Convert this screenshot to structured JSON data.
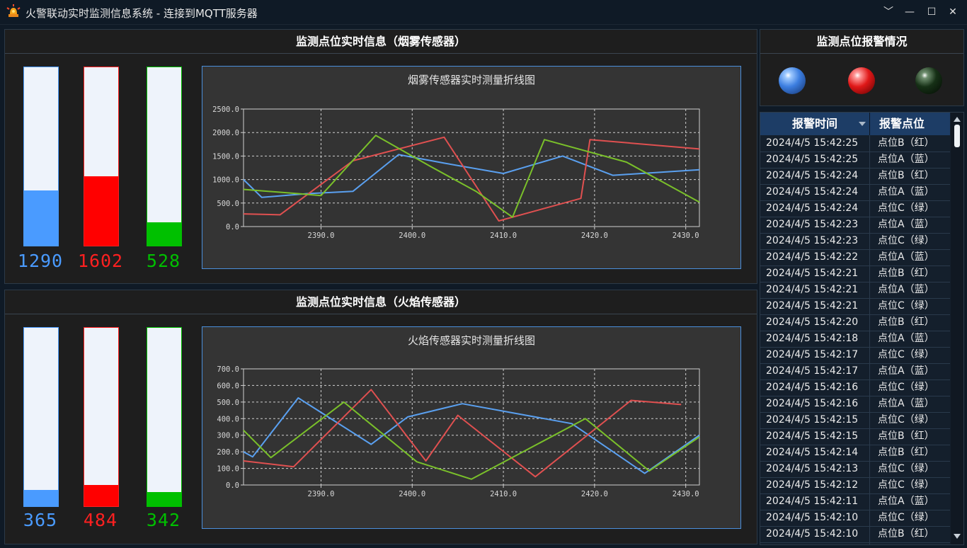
{
  "window": {
    "title": "火警联动实时监测信息系统 - 连接到MQTT服务器",
    "controls": [
      "﹀",
      "—",
      "☐",
      "✕"
    ]
  },
  "smoke_panel": {
    "title": "监测点位实时信息（烟雾传感器）",
    "readouts": [
      {
        "value": "1290",
        "level": 0.31,
        "color": "#4a9bff"
      },
      {
        "value": "1602",
        "level": 0.39,
        "color": "#ff0000"
      },
      {
        "value": "528",
        "level": 0.13,
        "color": "#00c000"
      }
    ],
    "chart_title": "烟雾传感器实时测量折线图"
  },
  "flame_panel": {
    "title": "监测点位实时信息（火焰传感器）",
    "readouts": [
      {
        "value": "365",
        "level": 0.09,
        "color": "#4a9bff"
      },
      {
        "value": "484",
        "level": 0.12,
        "color": "#ff0000"
      },
      {
        "value": "342",
        "level": 0.08,
        "color": "#00c000"
      }
    ],
    "chart_title": "火焰传感器实时测量折线图"
  },
  "alarm_panel": {
    "title": "监测点位报警情况",
    "lights": [
      {
        "name": "blue",
        "state": "on"
      },
      {
        "name": "red",
        "state": "on"
      },
      {
        "name": "green",
        "state": "off"
      }
    ]
  },
  "alarm_table": {
    "columns": [
      "报警时间",
      "报警点位"
    ],
    "rows": [
      [
        "2024/4/5 15:42:25",
        "点位B（红）"
      ],
      [
        "2024/4/5 15:42:25",
        "点位A（蓝）"
      ],
      [
        "2024/4/5 15:42:24",
        "点位B（红）"
      ],
      [
        "2024/4/5 15:42:24",
        "点位A（蓝）"
      ],
      [
        "2024/4/5 15:42:24",
        "点位C（绿）"
      ],
      [
        "2024/4/5 15:42:23",
        "点位A（蓝）"
      ],
      [
        "2024/4/5 15:42:23",
        "点位C（绿）"
      ],
      [
        "2024/4/5 15:42:22",
        "点位A（蓝）"
      ],
      [
        "2024/4/5 15:42:21",
        "点位B（红）"
      ],
      [
        "2024/4/5 15:42:21",
        "点位A（蓝）"
      ],
      [
        "2024/4/5 15:42:21",
        "点位C（绿）"
      ],
      [
        "2024/4/5 15:42:20",
        "点位B（红）"
      ],
      [
        "2024/4/5 15:42:18",
        "点位A（蓝）"
      ],
      [
        "2024/4/5 15:42:17",
        "点位C（绿）"
      ],
      [
        "2024/4/5 15:42:17",
        "点位A（蓝）"
      ],
      [
        "2024/4/5 15:42:16",
        "点位C（绿）"
      ],
      [
        "2024/4/5 15:42:16",
        "点位A（蓝）"
      ],
      [
        "2024/4/5 15:42:15",
        "点位C（绿）"
      ],
      [
        "2024/4/5 15:42:15",
        "点位B（红）"
      ],
      [
        "2024/4/5 15:42:14",
        "点位B（红）"
      ],
      [
        "2024/4/5 15:42:13",
        "点位C（绿）"
      ],
      [
        "2024/4/5 15:42:12",
        "点位C（绿）"
      ],
      [
        "2024/4/5 15:42:11",
        "点位A（蓝）"
      ],
      [
        "2024/4/5 15:42:10",
        "点位C（绿）"
      ],
      [
        "2024/4/5 15:42:10",
        "点位B（红）"
      ]
    ]
  },
  "chart_data": [
    {
      "type": "line",
      "title": "烟雾传感器实时测量折线图",
      "xlim": [
        2381.5,
        2431.5
      ],
      "ylim": [
        0,
        2500
      ],
      "xticks": [
        "2390.0",
        "2400.0",
        "2410.0",
        "2420.0",
        "2430.0"
      ],
      "yticks": [
        "0.0",
        "500.0",
        "1000.0",
        "1500.0",
        "2000.0",
        "2500.0"
      ],
      "grid": true,
      "series": [
        {
          "color": "#5aa0f0",
          "x": [
            2381.5,
            2383.5,
            2388.5,
            2393.5,
            2398.5,
            2403.5,
            2410.0,
            2416.5,
            2422.0,
            2431.5
          ],
          "y": [
            1000,
            620,
            700,
            750,
            1530,
            1350,
            1130,
            1500,
            1090,
            1210
          ]
        },
        {
          "color": "#e05050",
          "x": [
            2381.5,
            2385.5,
            2393.5,
            2403.5,
            2409.5,
            2418.5,
            2419.5,
            2431.5
          ],
          "y": [
            270,
            250,
            1400,
            1900,
            120,
            600,
            1850,
            1650
          ]
        },
        {
          "color": "#7ac02a",
          "x": [
            2381.5,
            2387.5,
            2390.0,
            2396.0,
            2402.0,
            2407.0,
            2411.0,
            2414.5,
            2423.5,
            2431.5
          ],
          "y": [
            790,
            700,
            660,
            1940,
            1280,
            750,
            200,
            1850,
            1370,
            520
          ]
        }
      ]
    },
    {
      "type": "line",
      "title": "火焰传感器实时测量折线图",
      "xlim": [
        2381.5,
        2431.5
      ],
      "ylim": [
        0,
        700
      ],
      "xticks": [
        "2390.0",
        "2400.0",
        "2410.0",
        "2420.0",
        "2430.0"
      ],
      "yticks": [
        "0.0",
        "100.0",
        "200.0",
        "300.0",
        "400.0",
        "500.0",
        "600.0",
        "700.0"
      ],
      "grid": true,
      "series": [
        {
          "color": "#5aa0f0",
          "x": [
            2381.5,
            2382.5,
            2387.5,
            2395.5,
            2399.5,
            2405.5,
            2417.5,
            2425.5,
            2431.5
          ],
          "y": [
            200,
            170,
            525,
            245,
            410,
            490,
            370,
            70,
            300
          ]
        },
        {
          "color": "#e05050",
          "x": [
            2381.5,
            2387.0,
            2395.5,
            2401.5,
            2405.0,
            2413.5,
            2424.0,
            2429.5
          ],
          "y": [
            145,
            110,
            575,
            145,
            420,
            50,
            510,
            485
          ]
        },
        {
          "color": "#7ac02a",
          "x": [
            2381.5,
            2384.5,
            2392.5,
            2400.5,
            2406.5,
            2419.0,
            2426.0,
            2431.5
          ],
          "y": [
            330,
            165,
            500,
            140,
            35,
            400,
            85,
            290
          ]
        }
      ]
    }
  ]
}
